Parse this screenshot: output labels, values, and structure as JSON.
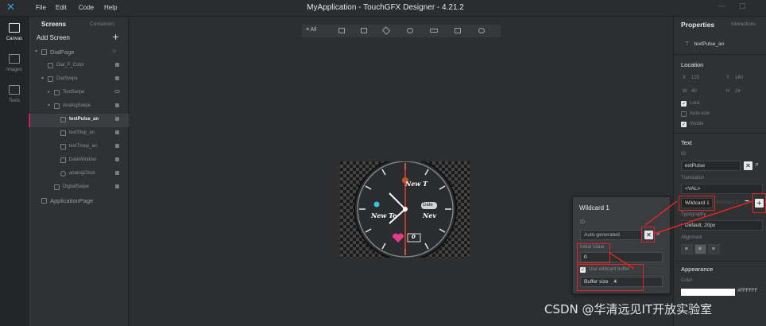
{
  "titlebar": {
    "title": "MyApplication - TouchGFX Designer - 4.21.2",
    "menu": [
      "File",
      "Edit",
      "Code",
      "Help"
    ]
  },
  "rail": [
    {
      "label": "Canvas",
      "icon": "canvas-icon"
    },
    {
      "label": "Images",
      "icon": "images-icon"
    },
    {
      "label": "Texts",
      "icon": "texts-icon"
    }
  ],
  "screens_panel": {
    "tab_screens": "Screens",
    "tab_containers": "Containers",
    "add_screen": "Add Screen",
    "add_plus": "+",
    "tree": [
      {
        "label": "DialPage",
        "level": 0
      },
      {
        "label": "Dial_F_Color",
        "level": 1
      },
      {
        "label": "DialSwipe",
        "level": 1
      },
      {
        "label": "TextSwipe",
        "level": 2
      },
      {
        "label": "AnalogSwipe",
        "level": 2
      },
      {
        "label": "textPulse_an",
        "level": 3,
        "selected": true
      },
      {
        "label": "textStep_an",
        "level": 3
      },
      {
        "label": "textTmep_an",
        "level": 3
      },
      {
        "label": "DateWindow",
        "level": 3
      },
      {
        "label": "analogClock",
        "level": 3
      },
      {
        "label": "DigitalSwipe",
        "level": 2
      },
      {
        "label": "ApplicationPage",
        "level": 0
      }
    ]
  },
  "canvas": {
    "toolbar_all": "≡ All",
    "watch": {
      "text_top": "New T",
      "text_left": "New Te",
      "text_right": "Nev",
      "date_label": "Date",
      "pulse_value": "0"
    }
  },
  "wildcard_popup": {
    "title": "Wildcard 1",
    "id_label": "ID",
    "id_value": "Auto-generated",
    "initial_label": "Initial Value",
    "initial_value": "0",
    "use_buffer_label": "Use wildcard buffer",
    "buffer_size_label": "Buffer size",
    "buffer_size_value": "4"
  },
  "properties": {
    "title": "Properties",
    "interactions": "Interactions",
    "widget_name": "textPulse_an",
    "location_title": "Location",
    "x_label": "X",
    "x_value": "125",
    "y_label": "Y",
    "y_value": "180",
    "w_label": "W",
    "w_value": "40",
    "h_label": "H",
    "h_value": "24",
    "lock": "Lock",
    "auto_size": "Auto-size",
    "visible": "Visible",
    "text_title": "Text",
    "id_label": "ID",
    "id_value": "extPulse",
    "translation_label": "Translation",
    "translation_value": "<VAL>",
    "wildcard1": "Wildcard 1",
    "wildcard2": "Wildcard 2",
    "typography_label": "Typography",
    "typography_value": "Default, 20px",
    "alignment_label": "Alignment",
    "appearance_title": "Appearance",
    "color_label": "Color",
    "color_value": "#FFFFFF"
  },
  "watermark": "CSDN @华清远见IT开放实验室",
  "colors": {
    "accent": "#2fa3e6",
    "selection": "#c0266a",
    "highlight_red": "#e0252a"
  }
}
